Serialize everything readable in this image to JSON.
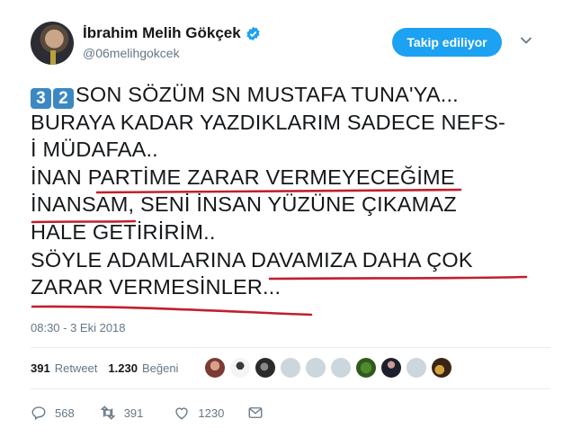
{
  "author": {
    "display_name": "İbrahim Melih Gökçek",
    "handle": "@06melihgokcek",
    "verified": true
  },
  "follow_button_label": "Takip ediliyor",
  "tweet": {
    "keycaps": [
      "3",
      "2"
    ],
    "line1": "SON SÖZÜM SN MUSTAFA TUNA'YA...",
    "line2": "BURAYA KADAR YAZDIKLARIM SADECE NEFS-",
    "line3": "İ MÜDAFAA..",
    "line4_a": "İNAN ",
    "line4_b": "PARTİME ZARAR VERMEYECEĞİME",
    "line5_a": "İNANSAM",
    "line5_b": ", SENİ İNSAN YÜZÜNE ÇIKAMAZ",
    "line6": "HALE GETİRİRİM..",
    "line7_a": "SÖYLE ADAMLARINA ",
    "line7_b": "DAVAMIZA DAHA ÇOK",
    "line8": "ZARAR VERMESİNLER..."
  },
  "timestamp": "08:30 - 3 Eki 2018",
  "stats": {
    "retweet_count": "391",
    "retweet_label": "Retweet",
    "like_count": "1.230",
    "like_label": "Beğeni"
  },
  "liker_avatar_count": 10,
  "actions": {
    "reply_count": "568",
    "retweet_count": "391",
    "like_count": "1230"
  },
  "colors": {
    "accent": "#1da1f2",
    "underline": "#c0202d",
    "keycap": "#3b88c3",
    "muted": "#657786"
  },
  "icons": [
    "verified-badge-icon",
    "chevron-down-icon",
    "reply-icon",
    "retweet-icon",
    "like-icon",
    "direct-message-icon"
  ]
}
